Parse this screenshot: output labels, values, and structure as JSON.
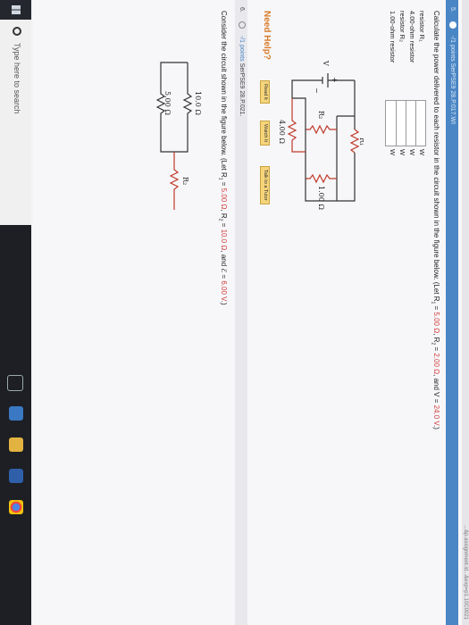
{
  "url": "...&p.assignment.id...&exp=p1.10C0021",
  "q5": {
    "number": "5.",
    "points": "-/1 points",
    "problem_id": "SerPSE9 28.P.017.WI",
    "text_before": "Calculate the power delivered to each resistor in the circuit shown in the figure below. (Let R",
    "text_sub1": "1",
    "text_mid1": " = ",
    "r1": "5.00 Ω",
    "text_mid2": ", R",
    "text_sub2": "2",
    "text_mid3": " = ",
    "r2": "2.00 Ω",
    "text_mid4": ", and V = ",
    "v": "24.0 V",
    "text_end": ".)",
    "answers": [
      {
        "label": "resistor R₁",
        "value": "",
        "unit": "W"
      },
      {
        "label": "4.00-ohm resistor",
        "value": "",
        "unit": "W"
      },
      {
        "label": "resistor R₂",
        "value": "",
        "unit": "W"
      },
      {
        "label": "1.00-ohm resistor",
        "value": "",
        "unit": "W"
      }
    ],
    "circuit": {
      "r1": "R₁",
      "r2": "R₂",
      "v": "V",
      "plus": "+",
      "minus": "−",
      "r4": "4.00 Ω",
      "r1ohm": "1.00 Ω"
    },
    "need_help": "Need Help?",
    "buttons": [
      "Read It",
      "Watch It",
      "Talk to a Tutor"
    ]
  },
  "q6": {
    "number": "6.",
    "points": "-/1 points",
    "problem_id": "SerPSE9 28.P.021.",
    "text_before": "Consider the circuit shown in the figure below. (Let R",
    "text_sub1": "1",
    "text_mid1": " = ",
    "r1": "5.00 Ω",
    "text_mid2": ", R",
    "text_sub2": "2",
    "text_mid3": " = ",
    "r2": "10.0 Ω",
    "text_mid4": ", and ℰ = ",
    "emf": "6.00 V",
    "text_end": ".)",
    "circuit": {
      "top": "10.0 Ω",
      "r2": "R₂",
      "bottom": "5.00 Ω"
    }
  },
  "taskbar": {
    "search_placeholder": "Type here to search"
  },
  "colors": {
    "header_blue": "#4a86c5",
    "value_red": "#d23c3c",
    "need_help_orange": "#d97b29",
    "help_button": "#f5d47a"
  }
}
